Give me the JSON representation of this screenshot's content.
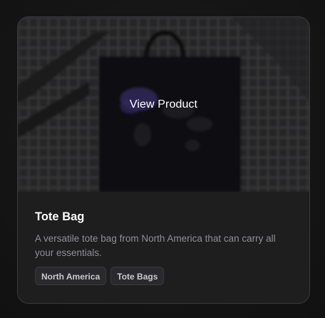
{
  "product": {
    "overlay_label": "View Product",
    "title": "Tote Bag",
    "description": "A versatile tote bag from North America that can carry all your essentials.",
    "tags": [
      "North America",
      "Tote Bags"
    ]
  },
  "colors": {
    "page_background": "#141414",
    "card_background": "#1e1e1f",
    "card_border": "#3a3a3d",
    "title_text": "#ffffff",
    "description_text": "#8f8f95",
    "tag_background": "#2a2a2c",
    "tag_text": "#c9c9ce",
    "map_accent": "#4b3f8a"
  }
}
